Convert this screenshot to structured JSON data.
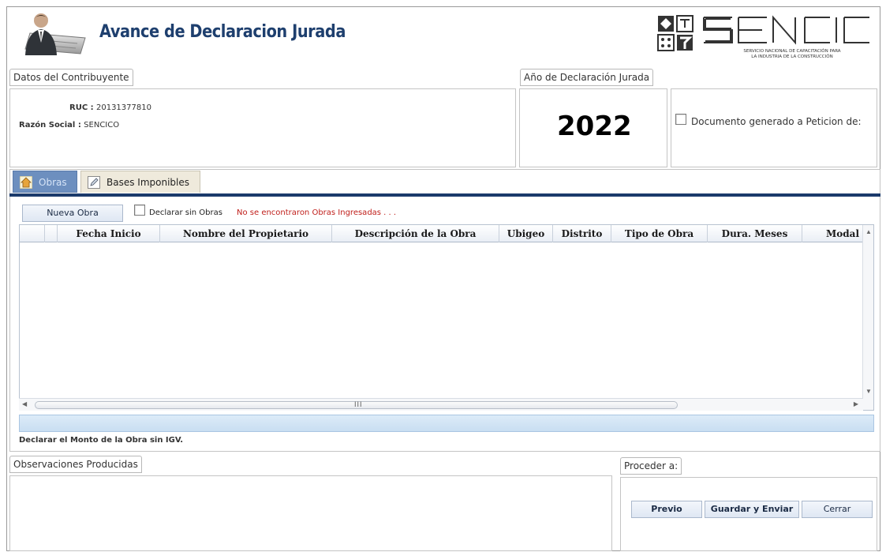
{
  "header": {
    "title": "Avance de Declaracion Jurada",
    "brand_name": "SENCICO",
    "brand_subtitle_1": "SERVICIO NACIONAL DE CAPACITACIÓN PARA",
    "brand_subtitle_2": "LA INDUSTRIA DE LA CONSTRUCCIÓN"
  },
  "contribuyente": {
    "legend": "Datos del Contribuyente",
    "ruc_label": "RUC :",
    "ruc_value": "20131377810",
    "razon_label": "Razón Social :",
    "razon_value": "SENCICO"
  },
  "anio": {
    "legend": "Año de Declaración Jurada",
    "value": "2022"
  },
  "peticion": {
    "checkbox_label": "Documento generado a Peticion de:"
  },
  "tabs": [
    {
      "label": "Obras",
      "active": true
    },
    {
      "label": "Bases Imponibles",
      "active": false
    }
  ],
  "obras": {
    "new_button": "Nueva Obra",
    "declarar_sin_obras": "Declarar sin Obras",
    "warning": "No se encontraron Obras Ingresadas . . .",
    "columns": [
      "",
      "",
      "Fecha Inicio",
      "Nombre del Propietario",
      "Descripción de la Obra",
      "Ubigeo",
      "Distrito",
      "Tipo de Obra",
      "Dura. Meses",
      "Modal"
    ],
    "rows": [],
    "scroll_grip": "III",
    "note": "Declarar el Monto de la Obra sin IGV."
  },
  "observaciones": {
    "legend": "Observaciones Producidas"
  },
  "proceder": {
    "legend": "Proceder a:",
    "buttons": [
      "Previo",
      "Guardar y Enviar",
      "Cerrar"
    ]
  },
  "colors": {
    "title": "#1e3f6e",
    "tab_active": "#6d8fbf",
    "tab_bar": "#1b3a6b",
    "warning": "#c0201c"
  }
}
